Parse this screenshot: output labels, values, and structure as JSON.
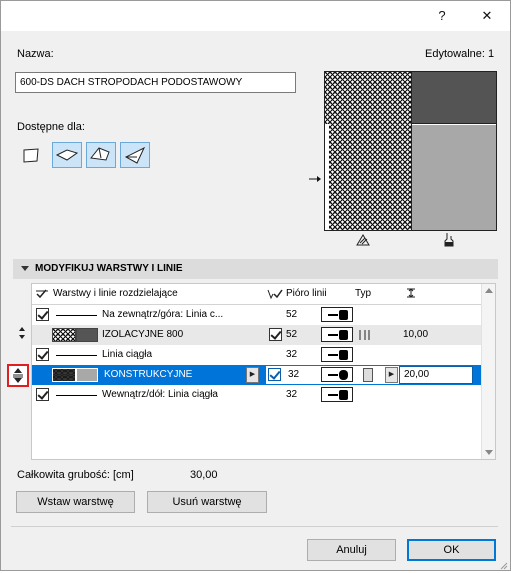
{
  "titlebar": {
    "help_label": "?",
    "close_label": "✕"
  },
  "name": {
    "label": "Nazwa:",
    "value": "600-DS DACH STROPODACH PODOSTAWOWY"
  },
  "editable": {
    "label": "Edytowalne: 1"
  },
  "available": {
    "label": "Dostępne dla:"
  },
  "section": {
    "title": "MODYFIKUJ WARSTWY I LINIE"
  },
  "table": {
    "headers": {
      "layers": "Warstwy i linie rozdzielające",
      "pen": "Pióro linii",
      "type": "Typ"
    },
    "rows": [
      {
        "label": "Na zewnątrz/góra: Linia c...",
        "pen": "52",
        "thickness": ""
      },
      {
        "label": "IZOLACYJNE 800",
        "pen": "52",
        "thickness": "10,00"
      },
      {
        "label": "Linia ciągła",
        "pen": "32",
        "thickness": ""
      },
      {
        "label": "KONSTRUKCYJNE",
        "pen": "32",
        "thickness": "20,00"
      },
      {
        "label": "Wewnątrz/dół: Linia ciągła",
        "pen": "32",
        "thickness": ""
      }
    ]
  },
  "total": {
    "label": "Całkowita grubość: [cm]",
    "value": "30,00"
  },
  "buttons": {
    "insert_layer": "Wstaw warstwę",
    "delete_layer": "Usuń warstwę",
    "cancel": "Anuluj",
    "ok": "OK"
  },
  "colors": {
    "selection": "#0074d9",
    "highlight_border": "#e02020"
  }
}
